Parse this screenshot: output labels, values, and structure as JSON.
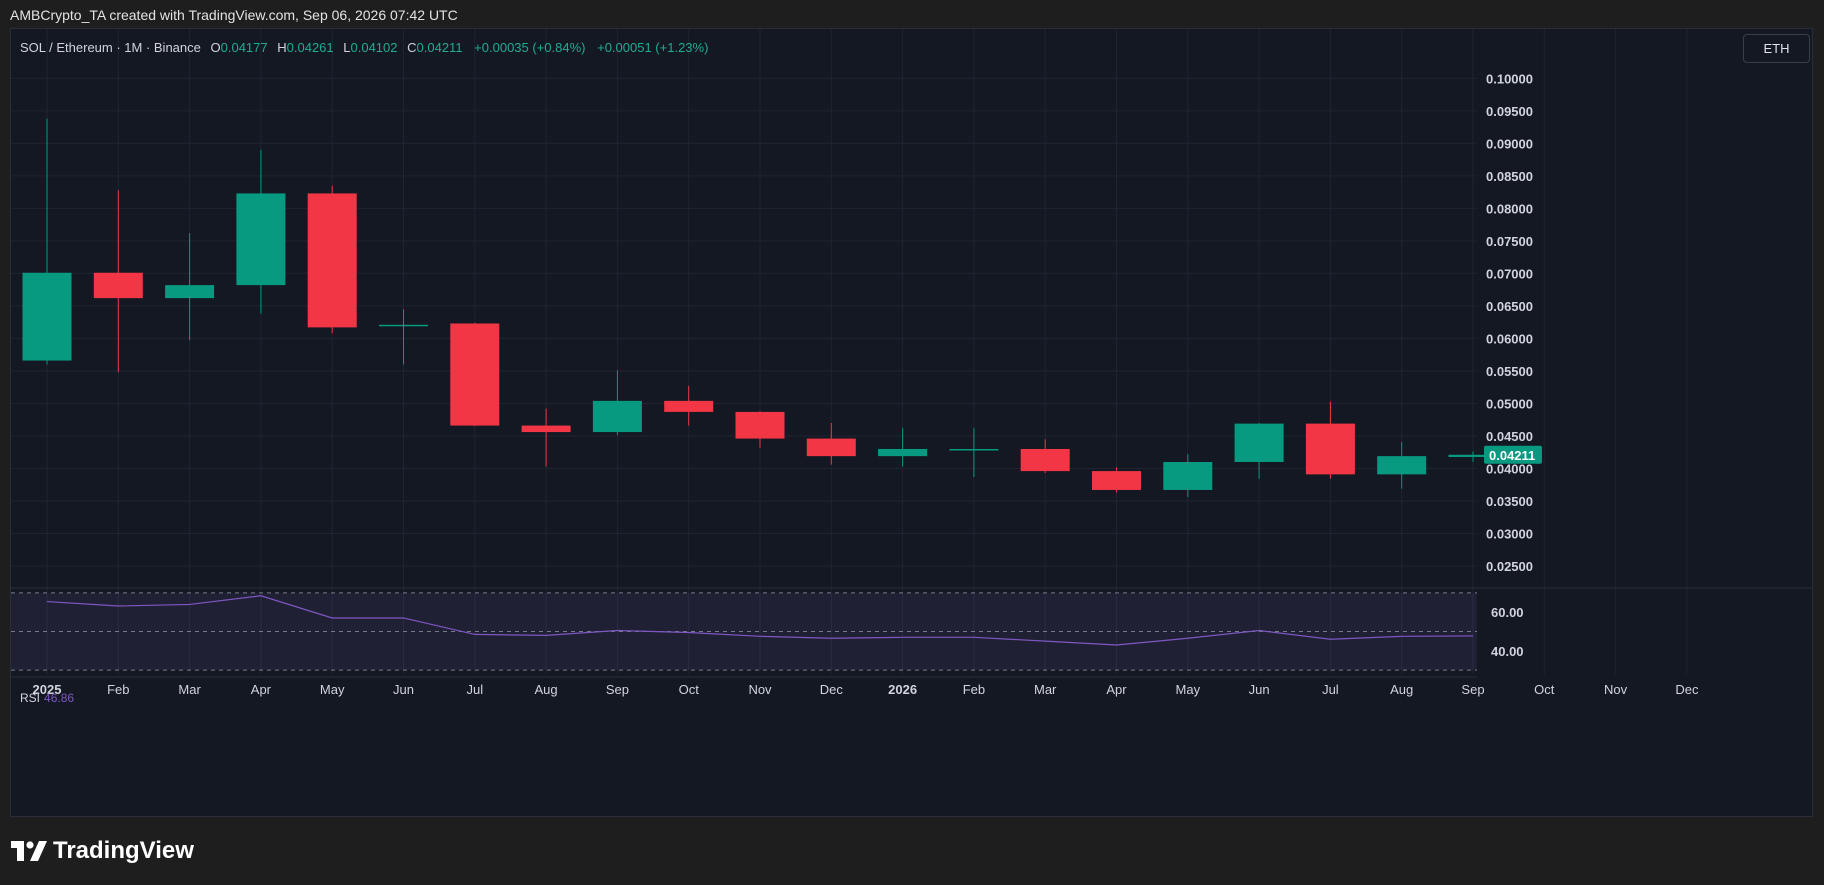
{
  "header": {
    "caption": "AMBCrypto_TA created with TradingView.com, Sep 06, 2026 07:42 UTC"
  },
  "legend": {
    "symbol": "SOL / Ethereum · 1M · Binance",
    "open_label": "O",
    "open": "0.04177",
    "high_label": "H",
    "high": "0.04261",
    "low_label": "L",
    "low": "0.04102",
    "close_label": "C",
    "close": "0.04211",
    "change": "+0.00035 (+0.84%)",
    "change2": "+0.00051 (+1.23%)"
  },
  "toolbar": {
    "currency_button": "ETH"
  },
  "footer": {
    "brand": "TradingView"
  },
  "colors": {
    "up": "#089981",
    "down": "#f23645",
    "rsi_line": "#7e57c2",
    "background": "#141822",
    "grid": "#1f2430",
    "text": "#d1d4dc"
  },
  "chart_data": [
    {
      "type": "candlestick",
      "title": "SOL / Ethereum · 1M · Binance",
      "interval": "1M",
      "x": [
        "2025",
        "Feb",
        "Mar",
        "Apr",
        "May",
        "Jun",
        "Jul",
        "Aug",
        "Sep",
        "Oct",
        "Nov",
        "Dec",
        "2026",
        "Feb",
        "Mar",
        "Apr",
        "May",
        "Jun",
        "Jul",
        "Aug",
        "Sep"
      ],
      "open": [
        0.0566,
        0.0701,
        0.0662,
        0.0682,
        0.0823,
        0.0621,
        0.0623,
        0.0466,
        0.0456,
        0.0504,
        0.0487,
        0.0446,
        0.0419,
        0.043,
        0.043,
        0.0396,
        0.0367,
        0.041,
        0.0469,
        0.0391,
        0.04177
      ],
      "high": [
        0.0938,
        0.0828,
        0.0762,
        0.089,
        0.0835,
        0.0645,
        0.0624,
        0.0492,
        0.0551,
        0.0527,
        0.0488,
        0.047,
        0.0462,
        0.0462,
        0.0445,
        0.0402,
        0.0422,
        0.047,
        0.0503,
        0.0441,
        0.04261
      ],
      "low": [
        0.056,
        0.0548,
        0.0597,
        0.0638,
        0.0608,
        0.056,
        0.0465,
        0.0403,
        0.0451,
        0.0466,
        0.0432,
        0.0406,
        0.0403,
        0.0387,
        0.0393,
        0.0363,
        0.0356,
        0.0384,
        0.0384,
        0.0369,
        0.04102
      ],
      "close": [
        0.0701,
        0.0662,
        0.0682,
        0.0823,
        0.0617,
        0.0621,
        0.0466,
        0.0456,
        0.0504,
        0.0487,
        0.0446,
        0.0419,
        0.043,
        0.043,
        0.0396,
        0.0367,
        0.041,
        0.0469,
        0.0391,
        0.0419,
        0.04211
      ],
      "y_ticks": [
        "0.10000",
        "0.09500",
        "0.09000",
        "0.08500",
        "0.08000",
        "0.07500",
        "0.07000",
        "0.06500",
        "0.06000",
        "0.05500",
        "0.05000",
        "0.04500",
        "0.04000",
        "0.03500",
        "0.03000",
        "0.02500"
      ],
      "ylim": [
        0.0227,
        0.1042
      ],
      "x_ticks": [
        "2025",
        "Feb",
        "Mar",
        "Apr",
        "May",
        "Jun",
        "Jul",
        "Aug",
        "Sep",
        "Oct",
        "Nov",
        "Dec",
        "2026",
        "Feb",
        "Mar",
        "Apr",
        "May",
        "Jun",
        "Jul",
        "Aug",
        "Sep",
        "Oct",
        "Nov",
        "Dec"
      ],
      "last_price": "0.04211",
      "grid": true
    },
    {
      "type": "line",
      "title": "RSI",
      "current_value": "46.86",
      "x": [
        "2025",
        "Feb",
        "Mar",
        "Apr",
        "May",
        "Jun",
        "Jul",
        "Aug",
        "Sep",
        "Oct",
        "Nov",
        "Dec",
        "2026",
        "Feb",
        "Mar",
        "Apr",
        "May",
        "Jun",
        "Jul",
        "Aug",
        "Sep"
      ],
      "values": [
        65.5,
        63.2,
        64.0,
        68.5,
        57.0,
        57.0,
        48.5,
        48.0,
        50.5,
        49.5,
        47.5,
        46.5,
        47.0,
        47.0,
        45.0,
        43.0,
        46.5,
        50.5,
        46.0,
        47.5,
        47.7
      ],
      "y_ticks": [
        "60.00",
        "40.00"
      ],
      "band_levels": [
        70,
        50,
        30
      ],
      "ylim": [
        28,
        72
      ]
    }
  ]
}
